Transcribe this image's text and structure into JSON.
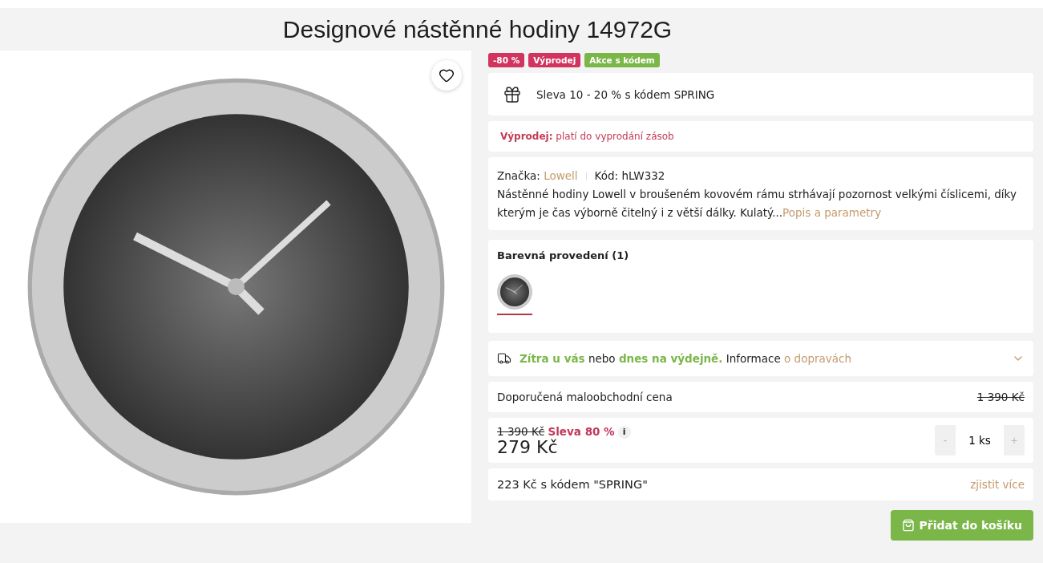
{
  "title": "Designové nástěnné hodiny 14972G",
  "badges": [
    {
      "label": "-80 %",
      "color": "#d0345f"
    },
    {
      "label": "Výprodej",
      "color": "#d0345f"
    },
    {
      "label": "Akce s kódem",
      "color": "#7ab648"
    }
  ],
  "promo": {
    "text": "Sleva 10 - 20 % s kódem SPRING"
  },
  "sale_note": {
    "label": "Výprodej:",
    "text": "platí do vyprodání zásob"
  },
  "info": {
    "brand_label": "Značka:",
    "brand": "Lowell",
    "code": "Kód: hLW332",
    "description": "Nástěnné hodiny Lowell v broušeném kovovém rámu strhávají pozornost velkými číslicemi, díky kterým je čas výborně čitelný i z větší dálky. Kulatý...",
    "more_link": "Popis a parametry"
  },
  "variants": {
    "title": "Barevná provedení (1)",
    "items": [
      {
        "selected": true
      }
    ]
  },
  "delivery": {
    "text": "**Zítra u vás** nebo **dnes na výdejně.** Informace",
    "link": "o dopravách"
  },
  "recommended": {
    "label": "Doporučená maloobchodní cena",
    "price": "1 390 Kč"
  },
  "price": {
    "old": "1 390 Kč",
    "discount": "Sleva 80 %",
    "info": "i",
    "current": "279 Kč",
    "minus": "-",
    "quantity": "1 ks",
    "plus": "+"
  },
  "code_price": {
    "text": "223 Kč s kódem \"SPRING\"",
    "link": "zjistit více"
  },
  "cart_button": "Přidat do košíku"
}
